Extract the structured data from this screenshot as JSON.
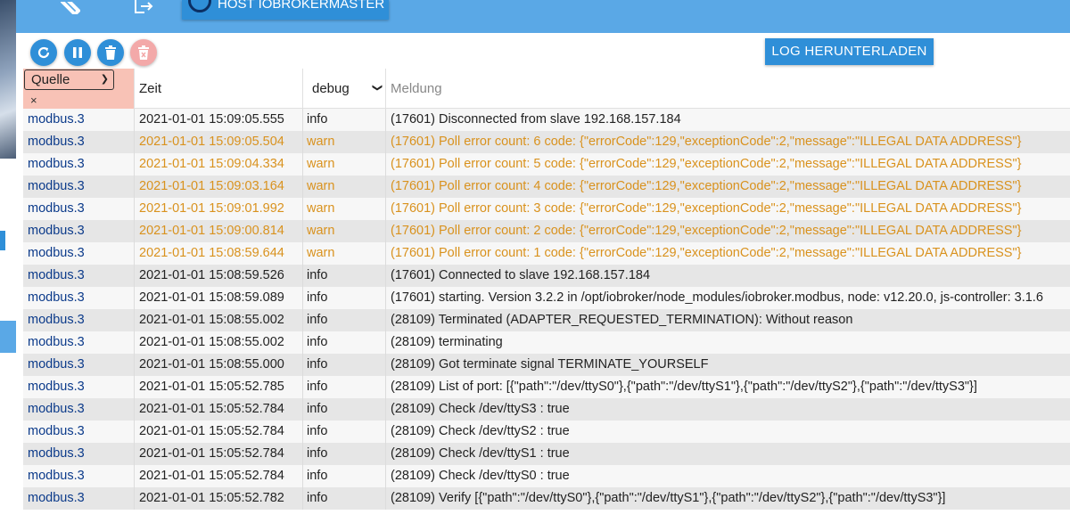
{
  "topbar": {
    "host_label": "HOST IOBROKERMASTER",
    "icons": [
      "wrench-icon",
      "logout-icon"
    ]
  },
  "toolbar": {
    "buttons": [
      "refresh-icon",
      "pause-icon",
      "delete-icon",
      "delete-disabled-icon"
    ],
    "download_label": "LOG HERUNTERLADEN"
  },
  "filters": {
    "source_select": "Quelle",
    "source_clear": "×",
    "time_label": "Zeit",
    "level_select": "debug",
    "message_placeholder": "Meldung"
  },
  "colors": {
    "accent": "#2f8fd8",
    "warn": "#d9921e",
    "source_link": "#0b3a8a",
    "filter_highlight": "#f8c2b6"
  },
  "rows": [
    {
      "source": "modbus.3",
      "time": "2021-01-01 15:09:05.555",
      "level": "info",
      "message": "(17601) Disconnected from slave 192.168.157.184"
    },
    {
      "source": "modbus.3",
      "time": "2021-01-01 15:09:05.504",
      "level": "warn",
      "message": "(17601) Poll error count: 6 code: {\"errorCode\":129,\"exceptionCode\":2,\"message\":\"ILLEGAL DATA ADDRESS\"}"
    },
    {
      "source": "modbus.3",
      "time": "2021-01-01 15:09:04.334",
      "level": "warn",
      "message": "(17601) Poll error count: 5 code: {\"errorCode\":129,\"exceptionCode\":2,\"message\":\"ILLEGAL DATA ADDRESS\"}"
    },
    {
      "source": "modbus.3",
      "time": "2021-01-01 15:09:03.164",
      "level": "warn",
      "message": "(17601) Poll error count: 4 code: {\"errorCode\":129,\"exceptionCode\":2,\"message\":\"ILLEGAL DATA ADDRESS\"}"
    },
    {
      "source": "modbus.3",
      "time": "2021-01-01 15:09:01.992",
      "level": "warn",
      "message": "(17601) Poll error count: 3 code: {\"errorCode\":129,\"exceptionCode\":2,\"message\":\"ILLEGAL DATA ADDRESS\"}"
    },
    {
      "source": "modbus.3",
      "time": "2021-01-01 15:09:00.814",
      "level": "warn",
      "message": "(17601) Poll error count: 2 code: {\"errorCode\":129,\"exceptionCode\":2,\"message\":\"ILLEGAL DATA ADDRESS\"}"
    },
    {
      "source": "modbus.3",
      "time": "2021-01-01 15:08:59.644",
      "level": "warn",
      "message": "(17601) Poll error count: 1 code: {\"errorCode\":129,\"exceptionCode\":2,\"message\":\"ILLEGAL DATA ADDRESS\"}"
    },
    {
      "source": "modbus.3",
      "time": "2021-01-01 15:08:59.526",
      "level": "info",
      "message": "(17601) Connected to slave 192.168.157.184"
    },
    {
      "source": "modbus.3",
      "time": "2021-01-01 15:08:59.089",
      "level": "info",
      "message": "(17601) starting. Version 3.2.2 in /opt/iobroker/node_modules/iobroker.modbus, node: v12.20.0, js-controller: 3.1.6"
    },
    {
      "source": "modbus.3",
      "time": "2021-01-01 15:08:55.002",
      "level": "info",
      "message": "(28109) Terminated (ADAPTER_REQUESTED_TERMINATION): Without reason"
    },
    {
      "source": "modbus.3",
      "time": "2021-01-01 15:08:55.002",
      "level": "info",
      "message": "(28109) terminating"
    },
    {
      "source": "modbus.3",
      "time": "2021-01-01 15:08:55.000",
      "level": "info",
      "message": "(28109) Got terminate signal TERMINATE_YOURSELF"
    },
    {
      "source": "modbus.3",
      "time": "2021-01-01 15:05:52.785",
      "level": "info",
      "message": "(28109) List of port: [{\"path\":\"/dev/ttyS0\"},{\"path\":\"/dev/ttyS1\"},{\"path\":\"/dev/ttyS2\"},{\"path\":\"/dev/ttyS3\"}]"
    },
    {
      "source": "modbus.3",
      "time": "2021-01-01 15:05:52.784",
      "level": "info",
      "message": "(28109) Check /dev/ttyS3 : true"
    },
    {
      "source": "modbus.3",
      "time": "2021-01-01 15:05:52.784",
      "level": "info",
      "message": "(28109) Check /dev/ttyS2 : true"
    },
    {
      "source": "modbus.3",
      "time": "2021-01-01 15:05:52.784",
      "level": "info",
      "message": "(28109) Check /dev/ttyS1 : true"
    },
    {
      "source": "modbus.3",
      "time": "2021-01-01 15:05:52.784",
      "level": "info",
      "message": "(28109) Check /dev/ttyS0 : true"
    },
    {
      "source": "modbus.3",
      "time": "2021-01-01 15:05:52.782",
      "level": "info",
      "message": "(28109) Verify [{\"path\":\"/dev/ttyS0\"},{\"path\":\"/dev/ttyS1\"},{\"path\":\"/dev/ttyS2\"},{\"path\":\"/dev/ttyS3\"}]"
    }
  ]
}
